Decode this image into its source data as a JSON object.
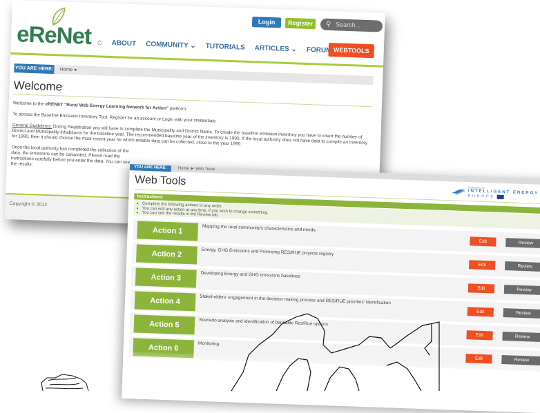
{
  "site": {
    "logo": "eReNet",
    "login": "Login",
    "register": "Register",
    "search_placeholder": "Search...",
    "nav": [
      "ABOUT",
      "COMMUNITY ⌄",
      "TUTORIALS",
      "ARTICLES ⌄",
      "FORUM"
    ],
    "webtools_button": "WEBTOOLS",
    "you_are_here": "YOU ARE HERE:",
    "crumb_home": "Home",
    "page_title": "Welcome",
    "welcome_prefix": "Welcome to the ",
    "welcome_bold": "eRENET \"Rural Web Energy Learning Network for Action\"",
    "welcome_suffix": " platform.",
    "access_text": "To access the Baseline Emission Inventory Tool, Register for an account or Login with your credentials.",
    "guidelines_label": "General Guidelines:",
    "guidelines_text": " During Registration you will have to complete the Municipality and District Name. To create the baseline emission inventory you have to insert the number of District and Municipality inhabitants for the baseline year. The recommended baseline year of the inventory is 1990. If the local authority does not have data to compile an inventory for 1990, then it should choose the most recent year for which reliable data can be collected, close to the year 1990.",
    "once_text": "Once the local authority has completed the collection of the data, the emissions can be calculated. Please read the instructions carefully before you enter the data. You can see the results.",
    "copyright": "Copyright © 2012"
  },
  "webtools": {
    "you_are_here": "YOU ARE HERE:",
    "path": "Home  ►  Web Tools",
    "title": "Web Tools",
    "sponsor_small": "Supported by",
    "sponsor_line1": "INTELLIGENT ENERGY",
    "sponsor_line2": "EUROPE",
    "instructions_heading": "Instructions",
    "instructions": [
      "Complete the following actions in any order.",
      "You can edit any action at any time, if you wish to change something.",
      "You can see the results in the Review tab."
    ],
    "edit_label": "Edit",
    "review_label": "Review",
    "actions": [
      {
        "label": "Action 1",
        "desc": "Mapping the rural community's characteristics and needs."
      },
      {
        "label": "Action 2",
        "desc": "Energy, GHG Emissions and Promising RES/RUE projects registry"
      },
      {
        "label": "Action 3",
        "desc": "Developing Energy and GHG emissions baselines"
      },
      {
        "label": "Action 4",
        "desc": "Stakeholders' engagement in the decision making process and RES/RUE priorities' identification"
      },
      {
        "label": "Action 5",
        "desc": "Scenario analysis and identification of bankable Res/Rue options"
      },
      {
        "label": "Action 6",
        "desc": "Monitoring"
      }
    ]
  },
  "colors": {
    "green": "#8db43a",
    "blue": "#2f78b8",
    "orange": "#f04e23",
    "grey": "#6b6b6b"
  }
}
